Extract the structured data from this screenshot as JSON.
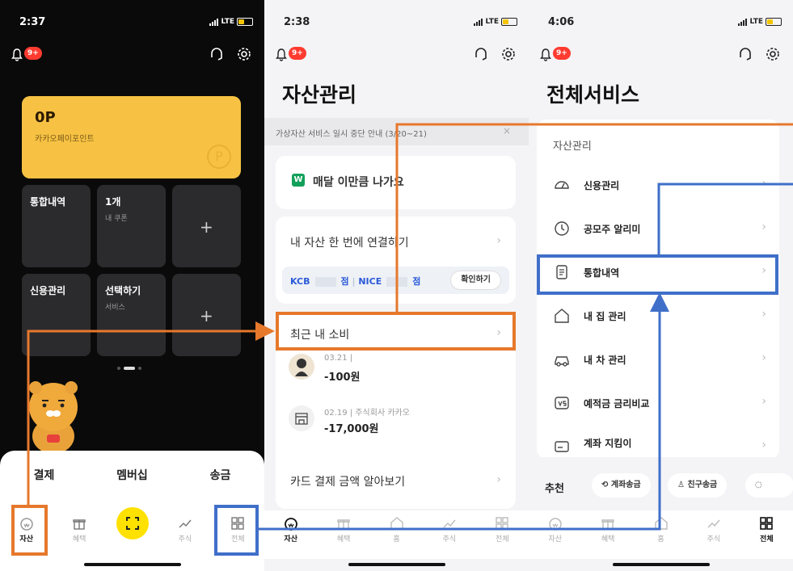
{
  "colors": {
    "orange": "#e6782c",
    "blue": "#3f6fc9",
    "kakao_yellow": "#f7c243",
    "scan_yellow": "#ffe100",
    "badge_red": "#ff3b30"
  },
  "panel1": {
    "status": {
      "time": "2:37",
      "network": "LTE"
    },
    "badge": "9+",
    "card": {
      "amount": "0P",
      "label": "카카오페이포인트",
      "coin_symbol": "P"
    },
    "tiles": [
      {
        "title": "통합내역",
        "sub": ""
      },
      {
        "title": "1개",
        "sub": "내 쿠폰"
      },
      {
        "title": "",
        "sub": "",
        "plus": "+"
      },
      {
        "title": "신용관리",
        "sub": ""
      },
      {
        "title": "선택하기",
        "sub": "서비스"
      },
      {
        "title": "",
        "sub": "",
        "plus": "+"
      }
    ],
    "sheet": [
      "결제",
      "멤버십",
      "송금"
    ],
    "nav": [
      "자산",
      "혜택",
      "",
      "주식",
      "전체"
    ]
  },
  "panel2": {
    "status": {
      "time": "2:38",
      "network": "LTE"
    },
    "badge": "9+",
    "title": "자산관리",
    "notice": "가상자산 서비스 일시 중단 안내 (3/20~21)",
    "notice_close": "×",
    "banner": "매달 이만큼 나가요",
    "banner_logo": "W",
    "connect": "내 자산 한 번에 연결하기",
    "kcb": {
      "kcb_label": "KCB",
      "kcb_suffix": "점",
      "nice_label": "NICE",
      "nice_suffix": "점",
      "button": "확인하기"
    },
    "recent": "최근 내 소비",
    "txns": [
      {
        "meta": "03.21 |",
        "amount": "-100원"
      },
      {
        "meta": "02.19 | 주식회사 카카오",
        "amount": "-17,000원"
      }
    ],
    "card_pay": "카드 결제 금액 알아보기",
    "nav": [
      "자산",
      "혜택",
      "홈",
      "주식",
      "전체"
    ]
  },
  "panel3": {
    "status": {
      "time": "4:06",
      "network": "LTE"
    },
    "badge": "9+",
    "title": "전체서비스",
    "section": "자산관리",
    "items": [
      "신용관리",
      "공모주 알리미",
      "통합내역",
      "내 집 관리",
      "내 차 관리",
      "예적금 금리비교",
      "계좌 지킴이"
    ],
    "rec_label": "추천",
    "chips": [
      "계좌송금",
      "친구송금"
    ],
    "nav": [
      "자산",
      "혜택",
      "홈",
      "주식",
      "전체"
    ]
  },
  "chevron": "›"
}
